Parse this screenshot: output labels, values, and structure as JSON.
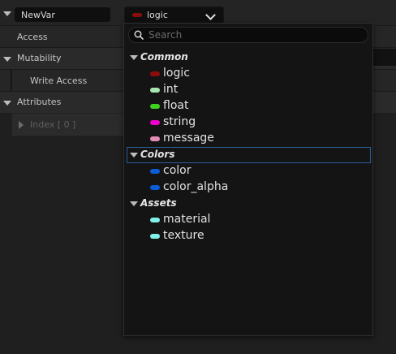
{
  "variable": {
    "name": "NewVar",
    "type_label": "logic",
    "type_color": "#8b0d0d"
  },
  "properties": {
    "access_label": "Access",
    "mutability_label": "Mutability",
    "write_access_label": "Write Access",
    "attributes_label": "Attributes",
    "index_label": "Index [ 0 ]"
  },
  "dropdown": {
    "search_placeholder": "Search",
    "categories": [
      {
        "name": "Common",
        "selected": false,
        "items": [
          {
            "label": "logic",
            "color": "#8b0d0d"
          },
          {
            "label": "int",
            "color": "#a8e6b0"
          },
          {
            "label": "float",
            "color": "#3fd01f"
          },
          {
            "label": "string",
            "color": "#f000c8"
          },
          {
            "label": "message",
            "color": "#e38cb8"
          }
        ]
      },
      {
        "name": "Colors",
        "selected": true,
        "items": [
          {
            "label": "color",
            "color": "#0b5cd6"
          },
          {
            "label": "color_alpha",
            "color": "#0b5cd6"
          }
        ]
      },
      {
        "name": "Assets",
        "selected": false,
        "items": [
          {
            "label": "material",
            "color": "#7ff0ea"
          },
          {
            "label": "texture",
            "color": "#7ff0ea"
          }
        ]
      }
    ]
  }
}
